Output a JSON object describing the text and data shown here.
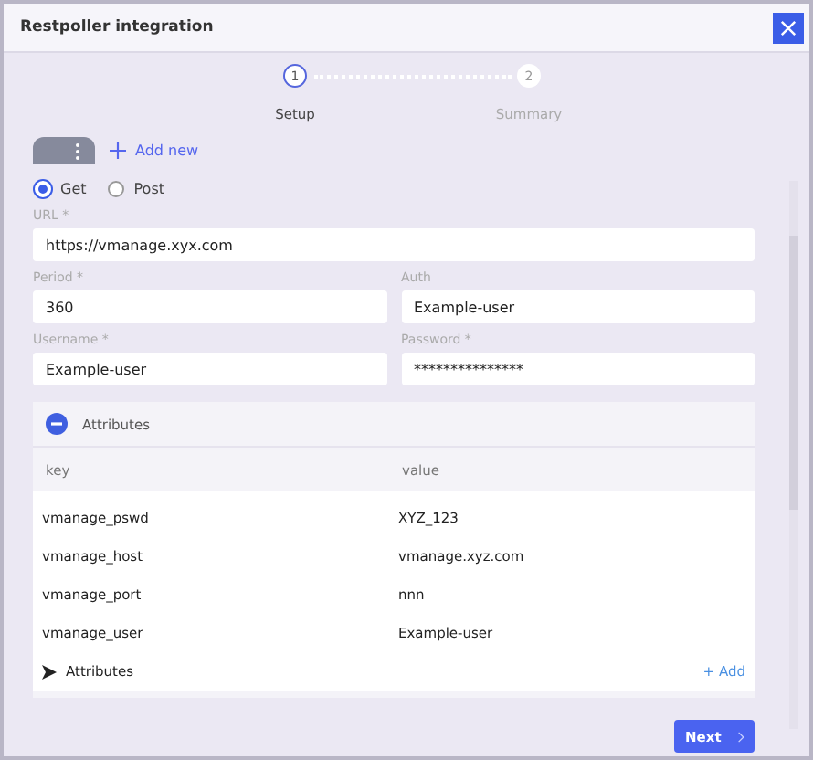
{
  "window": {
    "title": "Restpoller integration"
  },
  "steps": [
    {
      "number": "1",
      "label": "Setup",
      "selected": true
    },
    {
      "number": "2",
      "label": "Summary",
      "selected": false
    }
  ],
  "add_new": "Add new",
  "method": [
    {
      "label": "Get",
      "selected": true
    },
    {
      "label": "Post",
      "selected": false
    }
  ],
  "url": {
    "label": "URL *",
    "value": "https://vmanage.xyx.com"
  },
  "fields": [
    {
      "label": "Period *",
      "value": "360"
    },
    {
      "label": "Auth",
      "value": "Example-user"
    },
    {
      "label": "Username *",
      "value": "Example-user"
    },
    {
      "label": "Password *",
      "value": "***************"
    }
  ],
  "attributes": {
    "title": "Attributes",
    "expanded": true,
    "columns": [
      "key",
      "value"
    ],
    "rows": [
      {
        "key": "vmanage_pswd",
        "value": "XYZ_123"
      },
      {
        "key": "vmanage_host",
        "value": "vmanage.xyz.com"
      },
      {
        "key": "vmanage_port",
        "value": "nnn"
      },
      {
        "key": "vmanage_user",
        "value": "Example-user"
      }
    ],
    "footer": {
      "label": "Attributes",
      "add": "+ Add"
    }
  },
  "next_button": "Next"
}
